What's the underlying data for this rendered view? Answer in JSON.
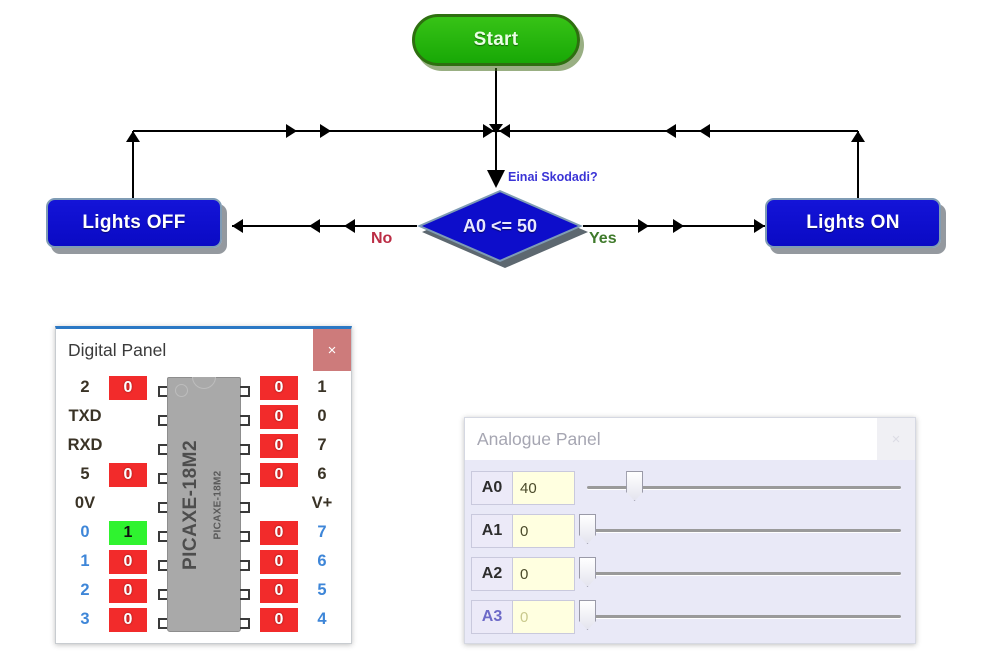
{
  "flowchart": {
    "start": {
      "label": "Start"
    },
    "decision": {
      "label": "A0 <= 50",
      "annotation": "Einai Skodadi?",
      "no_label": "No",
      "yes_label": "Yes"
    },
    "lights_off": {
      "label": "Lights OFF"
    },
    "lights_on": {
      "label": "Lights ON"
    },
    "colors": {
      "start_fill": "#1da806",
      "process_fill": "#0d0dcb",
      "decision_fill": "#0d0dcb",
      "no_text": "#bb2d45",
      "yes_text": "#3f7a2b",
      "annotation_text": "#3b34d6"
    }
  },
  "digital_panel": {
    "title": "Digital Panel",
    "close_label": "×",
    "chip_label": "PICAXE-18M2",
    "chip_label_small": "PICAXE-18M2",
    "rows": [
      {
        "left_name": "2",
        "left_state": "0",
        "left_kind": "off",
        "right_state": "0",
        "right_kind": "off",
        "right_name": "1"
      },
      {
        "left_name": "TXD",
        "left_state": "",
        "left_kind": "blank",
        "right_state": "0",
        "right_kind": "off",
        "right_name": "0"
      },
      {
        "left_name": "RXD",
        "left_state": "",
        "left_kind": "blank",
        "right_state": "0",
        "right_kind": "off",
        "right_name": "7"
      },
      {
        "left_name": "5",
        "left_state": "0",
        "left_kind": "off",
        "right_state": "0",
        "right_kind": "off",
        "right_name": "6"
      },
      {
        "left_name": "0V",
        "left_state": "",
        "left_kind": "blank",
        "right_state": "",
        "right_kind": "blank",
        "right_name": "V+"
      },
      {
        "left_name": "0",
        "left_state": "1",
        "left_kind": "on",
        "right_state": "0",
        "right_kind": "off",
        "right_name": "7",
        "blue": true
      },
      {
        "left_name": "1",
        "left_state": "0",
        "left_kind": "off",
        "right_state": "0",
        "right_kind": "off",
        "right_name": "6",
        "blue": true
      },
      {
        "left_name": "2",
        "left_state": "0",
        "left_kind": "off",
        "right_state": "0",
        "right_kind": "off",
        "right_name": "5",
        "blue": true
      },
      {
        "left_name": "3",
        "left_state": "0",
        "left_kind": "off",
        "right_state": "0",
        "right_kind": "off",
        "right_name": "4",
        "blue": true
      }
    ],
    "colors": {
      "led_on": "#2ff32f",
      "led_off": "#f22b2b",
      "close_button": "#cd7b7b",
      "title_border": "#2b78c4"
    }
  },
  "analogue_panel": {
    "title": "Analogue Panel",
    "close_label": "×",
    "channels": [
      {
        "name": "A0",
        "value": "40",
        "percent": 15,
        "dim": false
      },
      {
        "name": "A1",
        "value": "0",
        "percent": 0,
        "dim": false
      },
      {
        "name": "A2",
        "value": "0",
        "percent": 0,
        "dim": false
      },
      {
        "name": "A3",
        "value": "0",
        "percent": 0,
        "dim": true
      }
    ],
    "colors": {
      "body_bg": "#e9e9f7",
      "value_bg": "#ffffe0"
    }
  }
}
